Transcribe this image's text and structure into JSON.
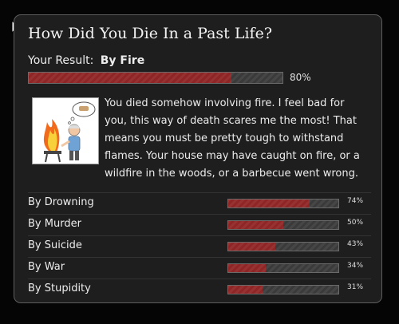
{
  "quiz": {
    "title": "How Did You Die In a Past Life?",
    "result_label": "Your Result:",
    "result_value": "By Fire",
    "result_percent": 80,
    "result_percent_text": "80%",
    "description": "You died somehow involving fire. I feel bad for you, this way of death scares me the most! That means you must be pretty tough to withstand flames. Your house may have caught on fire, or a wildfire in the woods, or a barbecue went wrong.",
    "illustration": "man-barbecue-fire-icon"
  },
  "other_results": [
    {
      "label": "By Drowning",
      "percent": 74,
      "percent_text": "74%"
    },
    {
      "label": "By Murder",
      "percent": 50,
      "percent_text": "50%"
    },
    {
      "label": "By Suicide",
      "percent": 43,
      "percent_text": "43%"
    },
    {
      "label": "By War",
      "percent": 34,
      "percent_text": "34%"
    },
    {
      "label": "By Stupidity",
      "percent": 31,
      "percent_text": "31%"
    }
  ],
  "colors": {
    "background": "#050505",
    "card": "#1e1e1e",
    "bar_fill": "#8f2525",
    "bar_track": "#3a3a3a"
  }
}
